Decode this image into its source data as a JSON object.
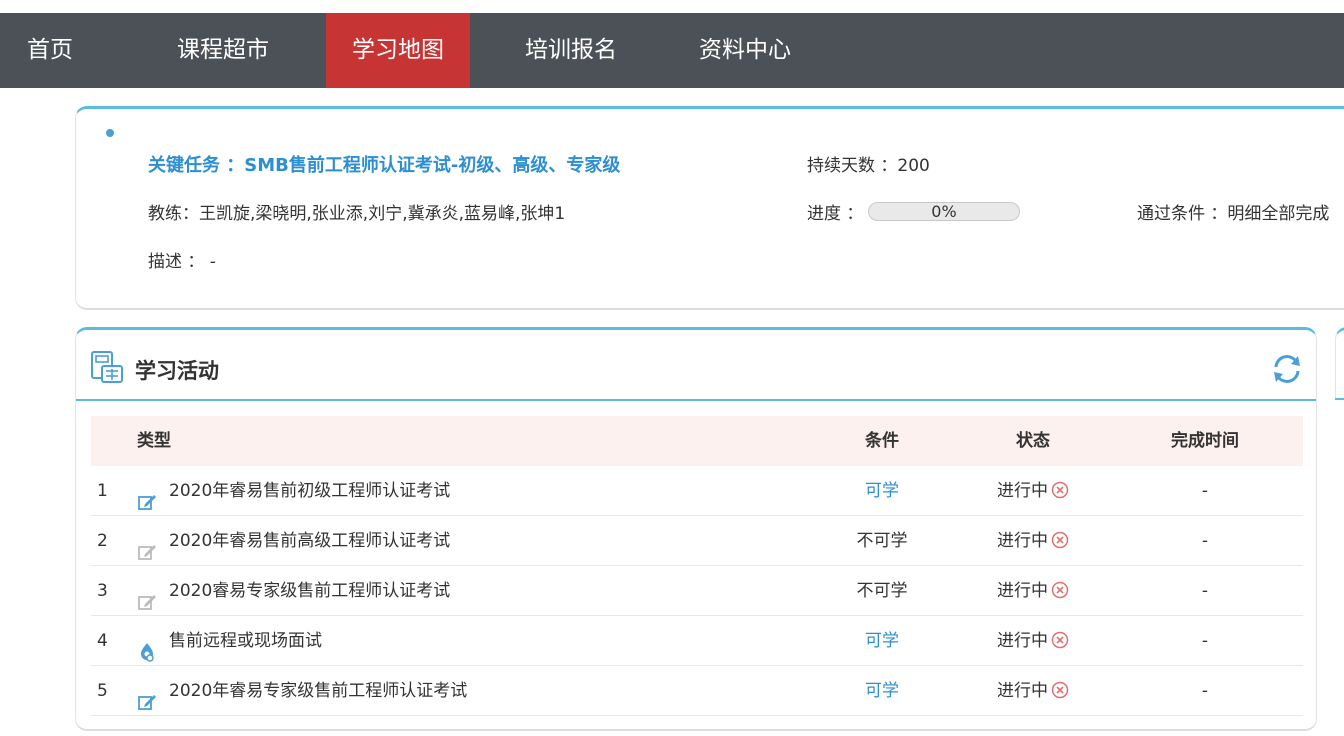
{
  "nav": {
    "items": [
      {
        "label": "首页",
        "active": false
      },
      {
        "label": "课程超市",
        "active": false
      },
      {
        "label": "学习地图",
        "active": true
      },
      {
        "label": "培训报名",
        "active": false
      },
      {
        "label": "资料中心",
        "active": false
      }
    ]
  },
  "task": {
    "title": "关键任务 ：SMB售前工程师认证考试-初级、高级、专家级",
    "coach": "教练：王凯旋,梁晓明,张业添,刘宁,冀承炎,蓝易峰,张坤1",
    "description": "描述 ： -",
    "duration": "持续天数 ：200",
    "progress_label": "进度 ：",
    "progress_value": 0,
    "progress_text": "0%",
    "pass_condition": "通过条件 ：明细全部完成"
  },
  "activities": {
    "title": "学习活动",
    "columns": {
      "type": "类型",
      "condition": "条件",
      "status": "状态",
      "completed_time": "完成时间"
    },
    "rows": [
      {
        "num": "1",
        "icon": "edit-icon-blue",
        "name": "2020年睿易售前初级工程师认证考试",
        "condition": "可学",
        "condition_link": true,
        "status": "进行中",
        "time": "-"
      },
      {
        "num": "2",
        "icon": "edit-icon-gray",
        "name": "2020年睿易售前高级工程师认证考试",
        "condition": "不可学",
        "condition_link": false,
        "status": "进行中",
        "time": "-"
      },
      {
        "num": "3",
        "icon": "edit-icon-gray",
        "name": "2020睿易专家级售前工程师认证考试",
        "condition": "不可学",
        "condition_link": false,
        "status": "进行中",
        "time": "-"
      },
      {
        "num": "4",
        "icon": "interview-icon",
        "name": "售前远程或现场面试",
        "condition": "可学",
        "condition_link": true,
        "status": "进行中",
        "time": "-"
      },
      {
        "num": "5",
        "icon": "edit-icon-blue",
        "name": "2020年睿易专家级售前工程师认证考试",
        "condition": "可学",
        "condition_link": true,
        "status": "进行中",
        "time": "-"
      }
    ]
  },
  "colors": {
    "nav_bg": "#4b5157",
    "nav_active": "#c63434",
    "accent": "#5bbcdc",
    "link": "#2d8fd1",
    "status_x": "#e07070",
    "header_row_bg": "#fdf1ef"
  }
}
